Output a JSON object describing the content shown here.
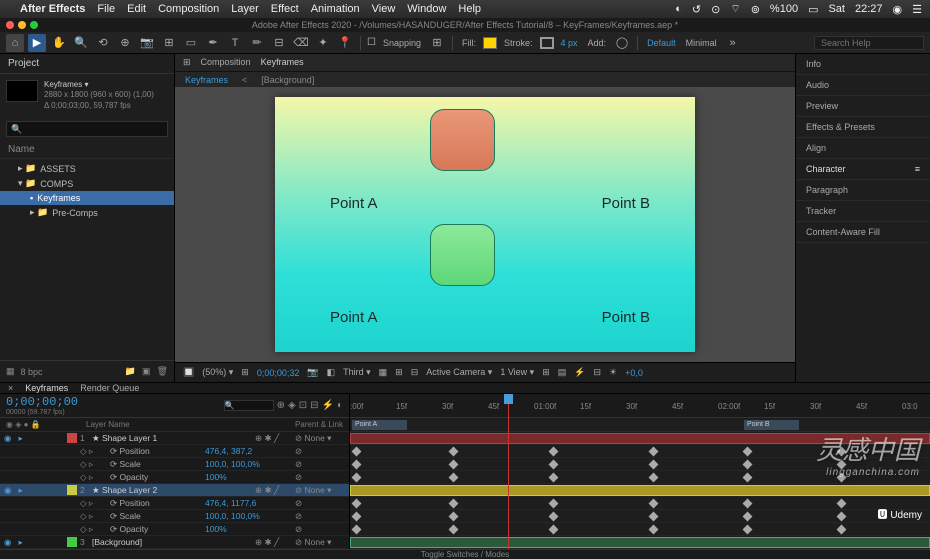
{
  "menubar": {
    "app": "After Effects",
    "items": [
      "File",
      "Edit",
      "Composition",
      "Layer",
      "Effect",
      "Animation",
      "View",
      "Window",
      "Help"
    ],
    "right": {
      "zoom": "%100",
      "day": "Sat",
      "time": "22:27"
    }
  },
  "titlebar": "Adobe After Effects 2020 - /Volumes/HASANDUGER/After Effects Tutorial/8 – KeyFrames/Keyframes.aep *",
  "toolbar": {
    "snapping": "Snapping",
    "fill": "Fill:",
    "stroke": "Stroke:",
    "strokepx": "4 px",
    "add": "Add:",
    "default": "Default",
    "minimal": "Minimal",
    "search_ph": "Search Help"
  },
  "project": {
    "title": "Project",
    "comp_name": "Keyframes ▾",
    "dims": "2880 x 1800  (960 x 600) (1,00)",
    "dur": "Δ 0;00;03;00, 59,787 fps",
    "tree_head": "Name",
    "items": [
      "ASSETS",
      "COMPS",
      "Keyframes",
      "Pre-Comps"
    ],
    "footer": [
      "8 bpc"
    ]
  },
  "comp": {
    "crumb_prefix": "Composition",
    "crumb": "Keyframes",
    "flow": [
      "Keyframes",
      "[Background]"
    ],
    "labels": {
      "pa": "Point A",
      "pb": "Point B"
    }
  },
  "viewerbar": {
    "zoom": "(50%)",
    "tc": "0;00;00;32",
    "res": "Third",
    "cam": "Active Camera",
    "views": "1 View",
    "extra": "+0,0"
  },
  "rightpanel": [
    "Info",
    "Audio",
    "Preview",
    "Effects & Presets",
    "Align",
    "Character",
    "Paragraph",
    "Tracker",
    "Content-Aware Fill"
  ],
  "timeline": {
    "tabs": [
      "Keyframes",
      "Render Queue"
    ],
    "tc": "0;00;00;00",
    "fps": "00000 (59.787 fps)",
    "cols": {
      "layer": "Layer Name",
      "parent": "Parent & Link"
    },
    "ruler": [
      ":00f",
      "15f",
      "30f",
      "45f",
      "01:00f",
      "15f",
      "30f",
      "45f",
      "02:00f",
      "15f",
      "30f",
      "45f",
      "03:0"
    ],
    "regions": {
      "a": "Point A",
      "b": "Point B"
    },
    "layers": [
      {
        "n": "1",
        "name": "★ Shape Layer 1",
        "tag": "red",
        "parent": "None",
        "props": [
          {
            "name": "Position",
            "val": "476,4, 387,2"
          },
          {
            "name": "Scale",
            "val": "100,0, 100,0%"
          },
          {
            "name": "Opacity",
            "val": "100%"
          }
        ]
      },
      {
        "n": "2",
        "name": "★ Shape Layer 2",
        "tag": "yel",
        "parent": "None",
        "sel": true,
        "props": [
          {
            "name": "Position",
            "val": "476,4, 1177,6"
          },
          {
            "name": "Scale",
            "val": "100,0, 100,0%"
          },
          {
            "name": "Opacity",
            "val": "100%"
          }
        ]
      },
      {
        "n": "3",
        "name": "[Background]",
        "tag": "grn",
        "parent": "None"
      }
    ],
    "footer": "Toggle Switches / Modes"
  },
  "watermark": {
    "main": "灵感中国",
    "sub": "lingganchina.com"
  },
  "udemy": "Udemy"
}
